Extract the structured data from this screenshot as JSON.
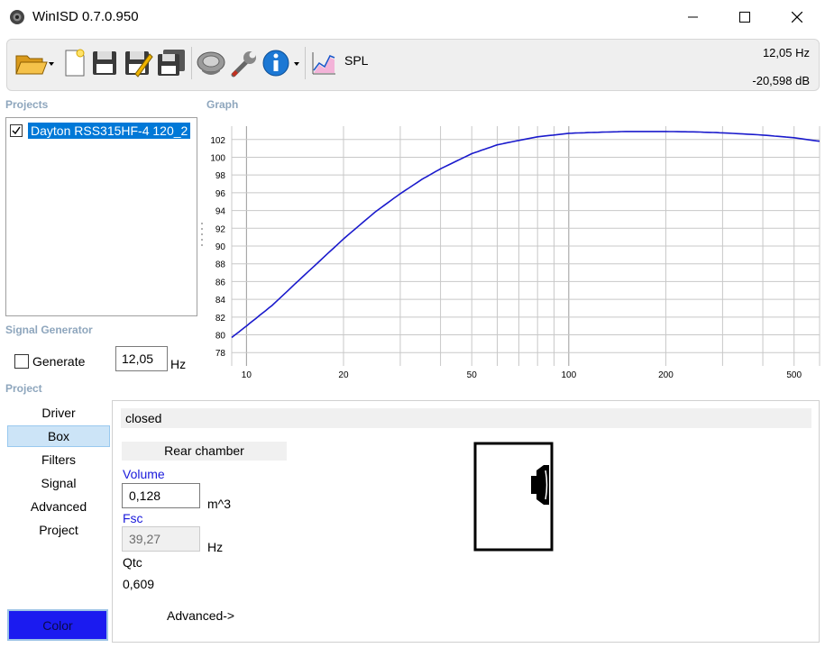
{
  "window": {
    "title": "WinISD 0.7.0.950"
  },
  "toolbar": {
    "spl_label": "SPL",
    "readout_freq": "12,05 Hz",
    "readout_level": "-20,598 dB"
  },
  "sections": {
    "projects": "Projects",
    "graph": "Graph",
    "signal_generator": "Signal Generator",
    "project": "Project"
  },
  "projects": {
    "items": [
      {
        "name": "Dayton RSS315HF-4 120_2",
        "checked": true
      }
    ]
  },
  "signal_generator": {
    "generate_label": "Generate",
    "frequency_value": "12,05",
    "unit": "Hz"
  },
  "nav": {
    "items": [
      "Driver",
      "Box",
      "Filters",
      "Signal",
      "Advanced",
      "Project"
    ],
    "active": "Box",
    "color_button": "Color"
  },
  "box_panel": {
    "box_type": "closed",
    "rear_chamber": "Rear chamber",
    "volume_label": "Volume",
    "volume_value": "0,128",
    "volume_unit": "m^3",
    "fsc_label": "Fsc",
    "fsc_value": "39,27",
    "fsc_unit": "Hz",
    "qtc_label": "Qtc",
    "qtc_value": "0,609",
    "advanced_link": "Advanced->"
  },
  "colors": {
    "curve": "#1a1acc",
    "selection": "#0078d7",
    "section_label": "#8ea6bd",
    "color_swatch": "#1b1bf0"
  },
  "chart_data": {
    "type": "line",
    "title": "",
    "xlabel": "",
    "ylabel": "",
    "x_scale": "log",
    "xlim": [
      9,
      600
    ],
    "ylim": [
      76.5,
      103.5
    ],
    "x_ticks": [
      10,
      20,
      50,
      100,
      200,
      500
    ],
    "y_ticks": [
      78,
      80,
      82,
      84,
      86,
      88,
      90,
      92,
      94,
      96,
      98,
      100,
      102
    ],
    "grid": true,
    "series": [
      {
        "name": "",
        "x": [
          9,
          10,
          12,
          15,
          20,
          25,
          30,
          35,
          40,
          50,
          60,
          70,
          80,
          100,
          120,
          150,
          200,
          250,
          300,
          400,
          500,
          600
        ],
        "y": [
          79.7,
          81.0,
          83.3,
          86.6,
          90.8,
          93.8,
          95.9,
          97.5,
          98.7,
          100.4,
          101.4,
          101.9,
          102.3,
          102.7,
          102.8,
          102.9,
          102.9,
          102.85,
          102.75,
          102.5,
          102.2,
          101.8
        ]
      }
    ]
  }
}
